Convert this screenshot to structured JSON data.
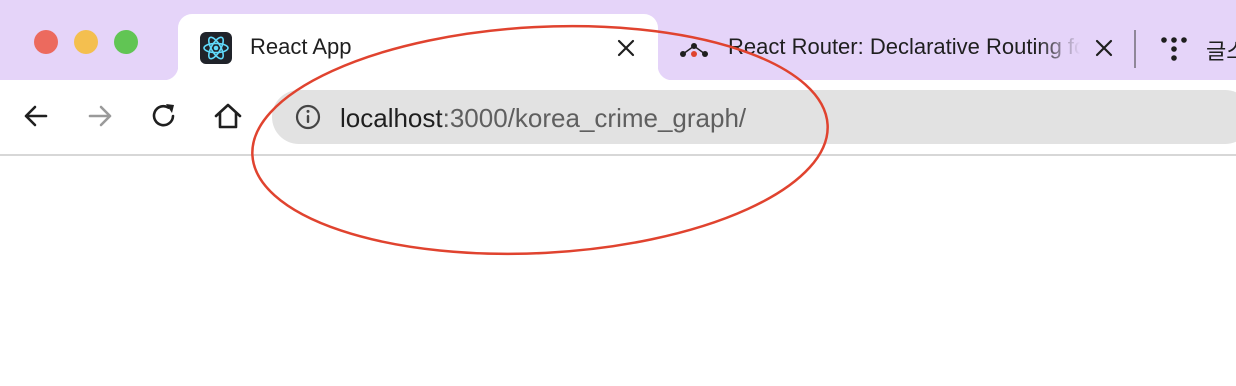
{
  "window": {
    "traffic_lights": {
      "close": "#ec6a5e",
      "minimize": "#f4bf4f",
      "maximize": "#61c554"
    },
    "titlebar_color": "#e5d4f9"
  },
  "tabs": [
    {
      "title": "React App",
      "favicon": "react-logo-icon",
      "active": true,
      "close_icon": "close-icon"
    },
    {
      "title": "React Router: Declarative Routing for React",
      "favicon": "react-router-icon",
      "active": false,
      "close_icon": "close-icon"
    },
    {
      "title": "글스",
      "favicon": "dots-grid-icon",
      "active": false
    }
  ],
  "toolbar": {
    "back_icon": "arrow-left-icon",
    "forward_icon": "arrow-right-icon",
    "reload_icon": "reload-icon",
    "home_icon": "home-icon"
  },
  "address_bar": {
    "info_icon": "info-icon",
    "host": "localhost",
    "path": ":3000/korea_crime_graph/"
  },
  "annotation": {
    "shape": "ellipse",
    "color": "#e0432f"
  }
}
